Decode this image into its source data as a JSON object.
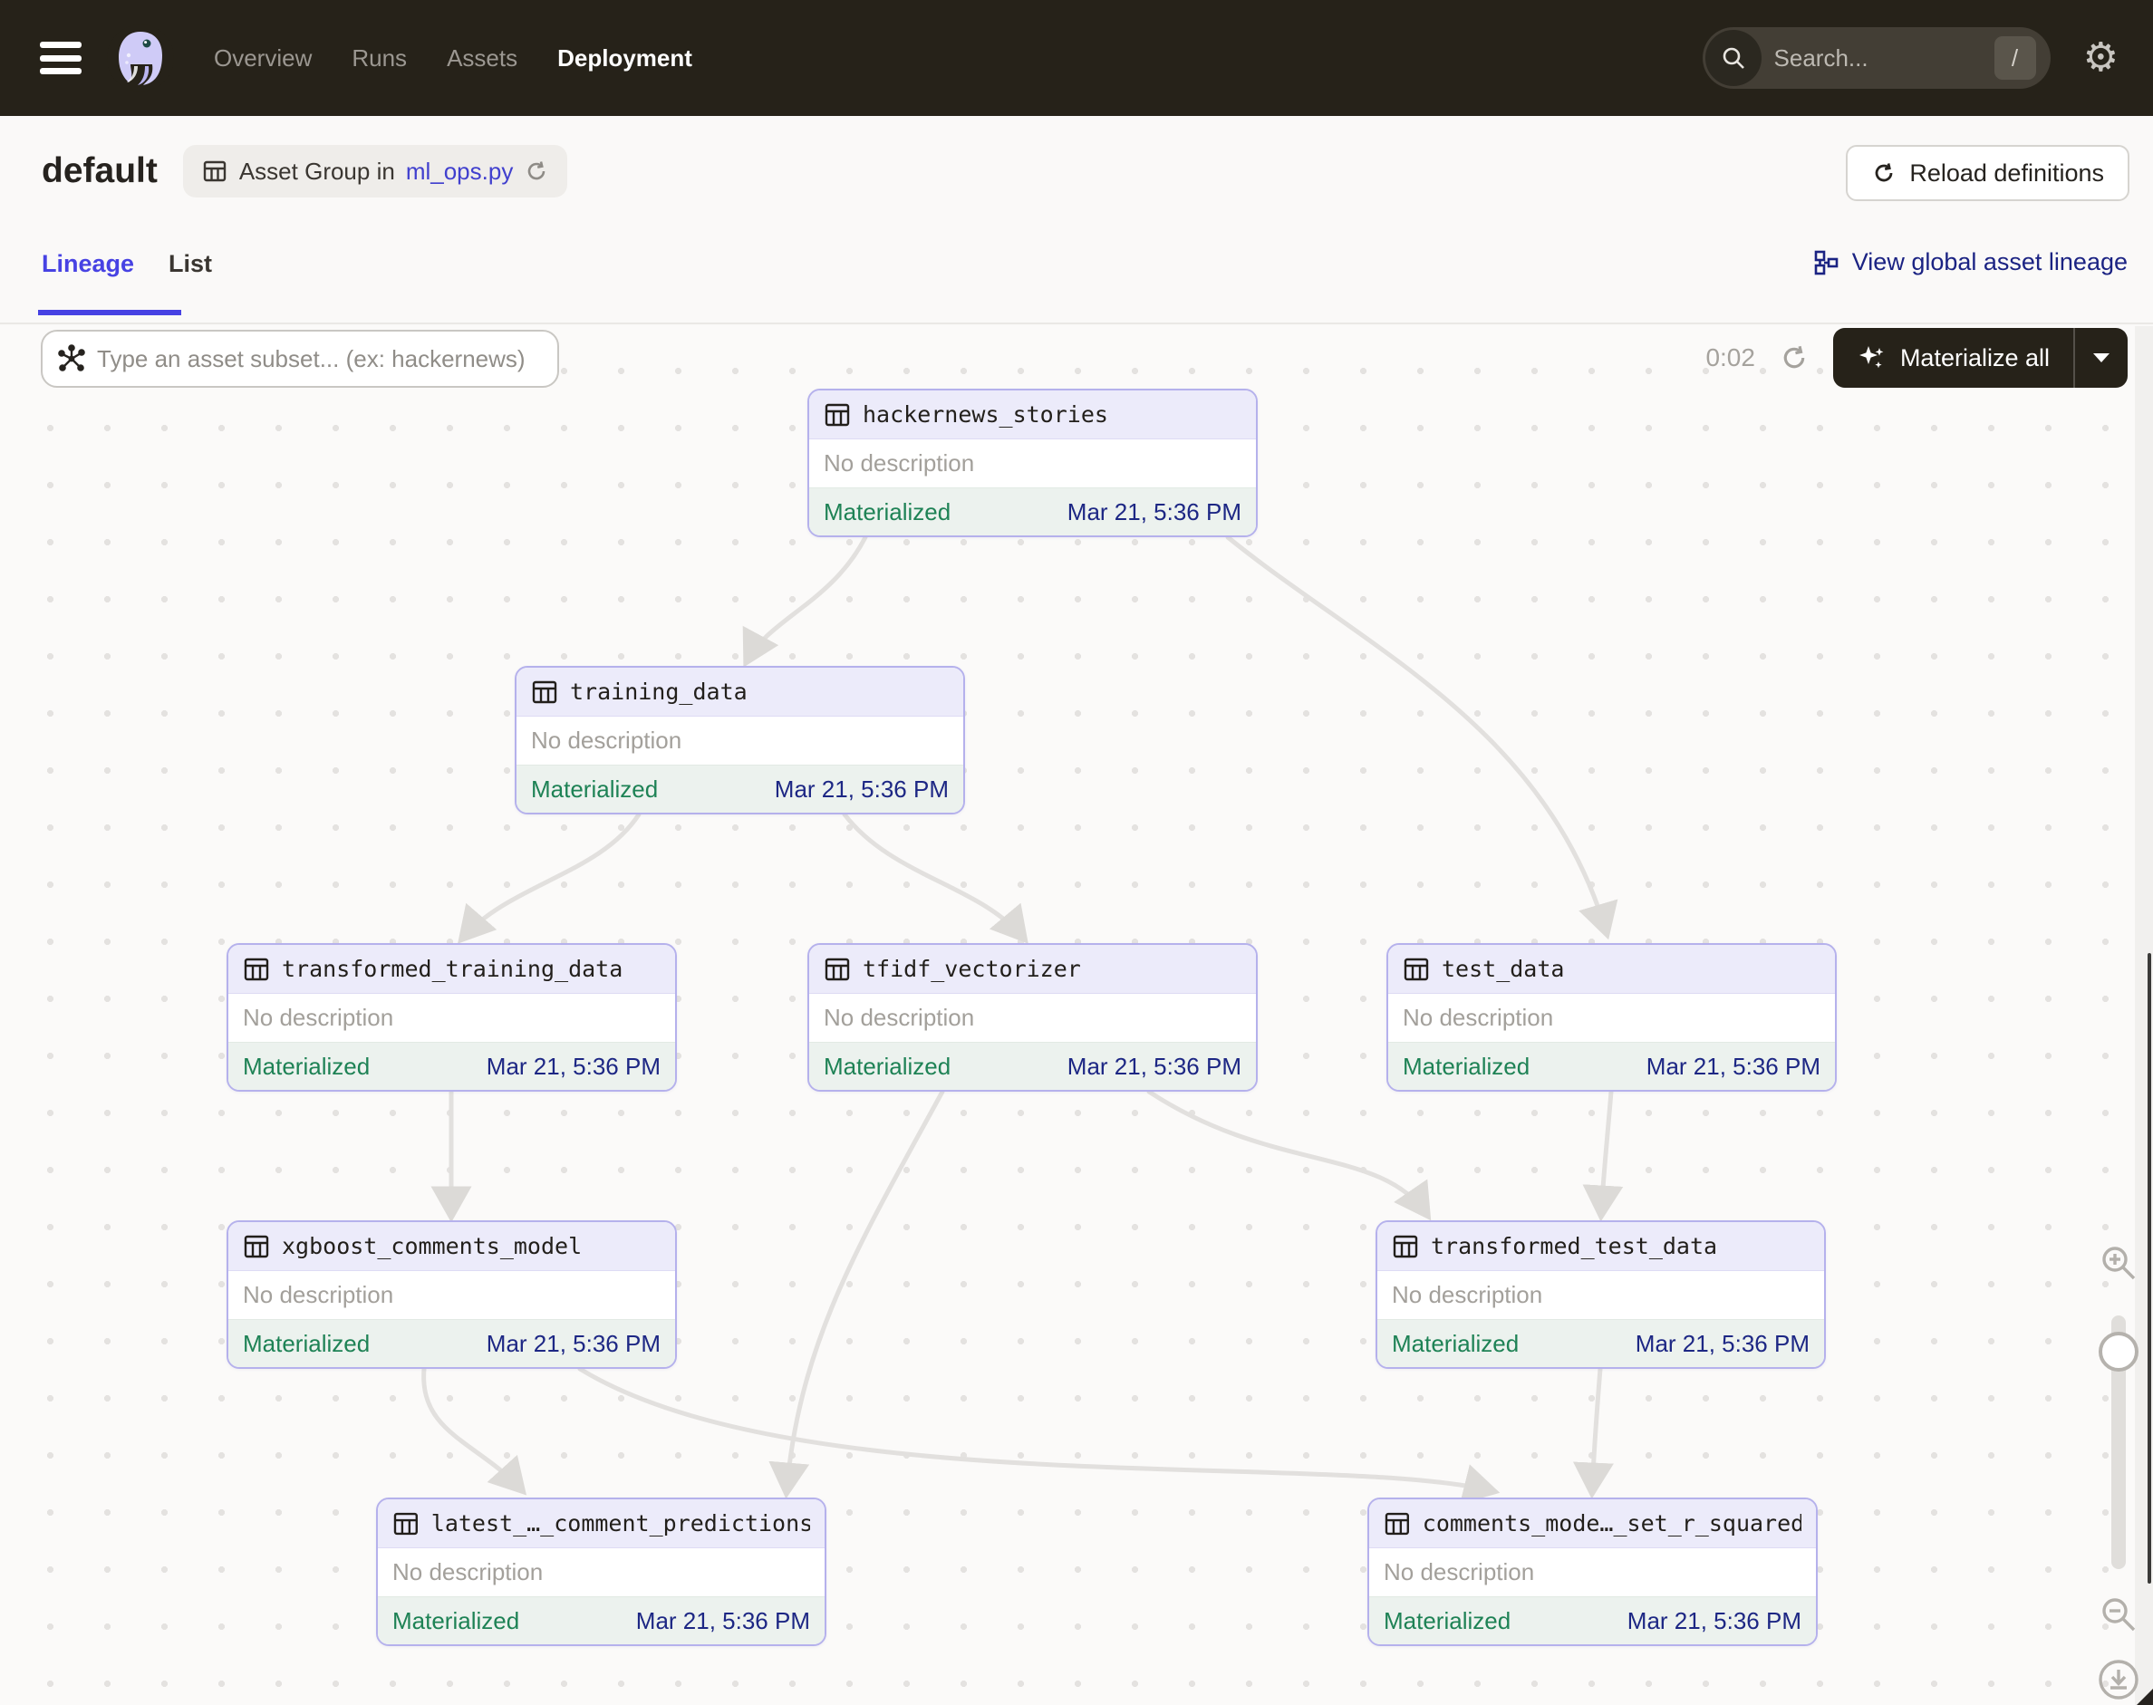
{
  "nav": {
    "items": [
      {
        "label": "Overview",
        "active": false
      },
      {
        "label": "Runs",
        "active": false
      },
      {
        "label": "Assets",
        "active": false
      },
      {
        "label": "Deployment",
        "active": true
      }
    ],
    "search": {
      "placeholder": "Search...",
      "shortcut": "/"
    },
    "icons": {
      "menu": "hamburger-icon",
      "logo": "dagster-octopus-logo",
      "search": "magnifier-icon",
      "settings": "gear-icon"
    }
  },
  "page": {
    "title": "default",
    "asset_group_prefix": "Asset Group in",
    "asset_group_file": "ml_ops.py",
    "reload_button": "Reload definitions"
  },
  "tabs": {
    "lineage": "Lineage",
    "list": "List",
    "view_global": "View global asset lineage"
  },
  "toolbar": {
    "filter_placeholder": "Type an asset subset... (ex: hackernews)",
    "timer": "0:02",
    "materialize": "Materialize all"
  },
  "graph": {
    "nodes": [
      {
        "name": "hackernews_stories",
        "description": "No description",
        "status": "Materialized",
        "timestamp": "Mar 21, 5:36 PM"
      },
      {
        "name": "training_data",
        "description": "No description",
        "status": "Materialized",
        "timestamp": "Mar 21, 5:36 PM"
      },
      {
        "name": "transformed_training_data",
        "description": "No description",
        "status": "Materialized",
        "timestamp": "Mar 21, 5:36 PM"
      },
      {
        "name": "tfidf_vectorizer",
        "description": "No description",
        "status": "Materialized",
        "timestamp": "Mar 21, 5:36 PM"
      },
      {
        "name": "test_data",
        "description": "No description",
        "status": "Materialized",
        "timestamp": "Mar 21, 5:36 PM"
      },
      {
        "name": "xgboost_comments_model",
        "description": "No description",
        "status": "Materialized",
        "timestamp": "Mar 21, 5:36 PM"
      },
      {
        "name": "transformed_test_data",
        "description": "No description",
        "status": "Materialized",
        "timestamp": "Mar 21, 5:36 PM"
      },
      {
        "name": "latest_…_comment_predictions",
        "description": "No description",
        "status": "Materialized",
        "timestamp": "Mar 21, 5:36 PM"
      },
      {
        "name": "comments_mode…_set_r_squared",
        "description": "No description",
        "status": "Materialized",
        "timestamp": "Mar 21, 5:36 PM"
      }
    ],
    "edges": [
      "hackernews_stories→training_data",
      "hackernews_stories→test_data",
      "training_data→transformed_training_data",
      "training_data→tfidf_vectorizer",
      "transformed_training_data→xgboost_comments_model",
      "tfidf_vectorizer→latest_…_comment_predictions",
      "tfidf_vectorizer→transformed_test_data",
      "test_data→transformed_test_data",
      "xgboost_comments_model→latest_…_comment_predictions",
      "xgboost_comments_model→comments_mode…_set_r_squared",
      "transformed_test_data→comments_mode…_set_r_squared"
    ]
  },
  "colors": {
    "navbar_bg": "#262219",
    "accent_indigo": "#4742E3",
    "link_blue": "#4140CE",
    "navy_timestamp": "#1D2784",
    "materialized_green": "#1E8255",
    "node_border": "#B5B1EC",
    "node_header_bg": "#ECEBFA",
    "node_footer_bg": "#ECF2EE",
    "edge_gray": "#E2E0DE"
  }
}
